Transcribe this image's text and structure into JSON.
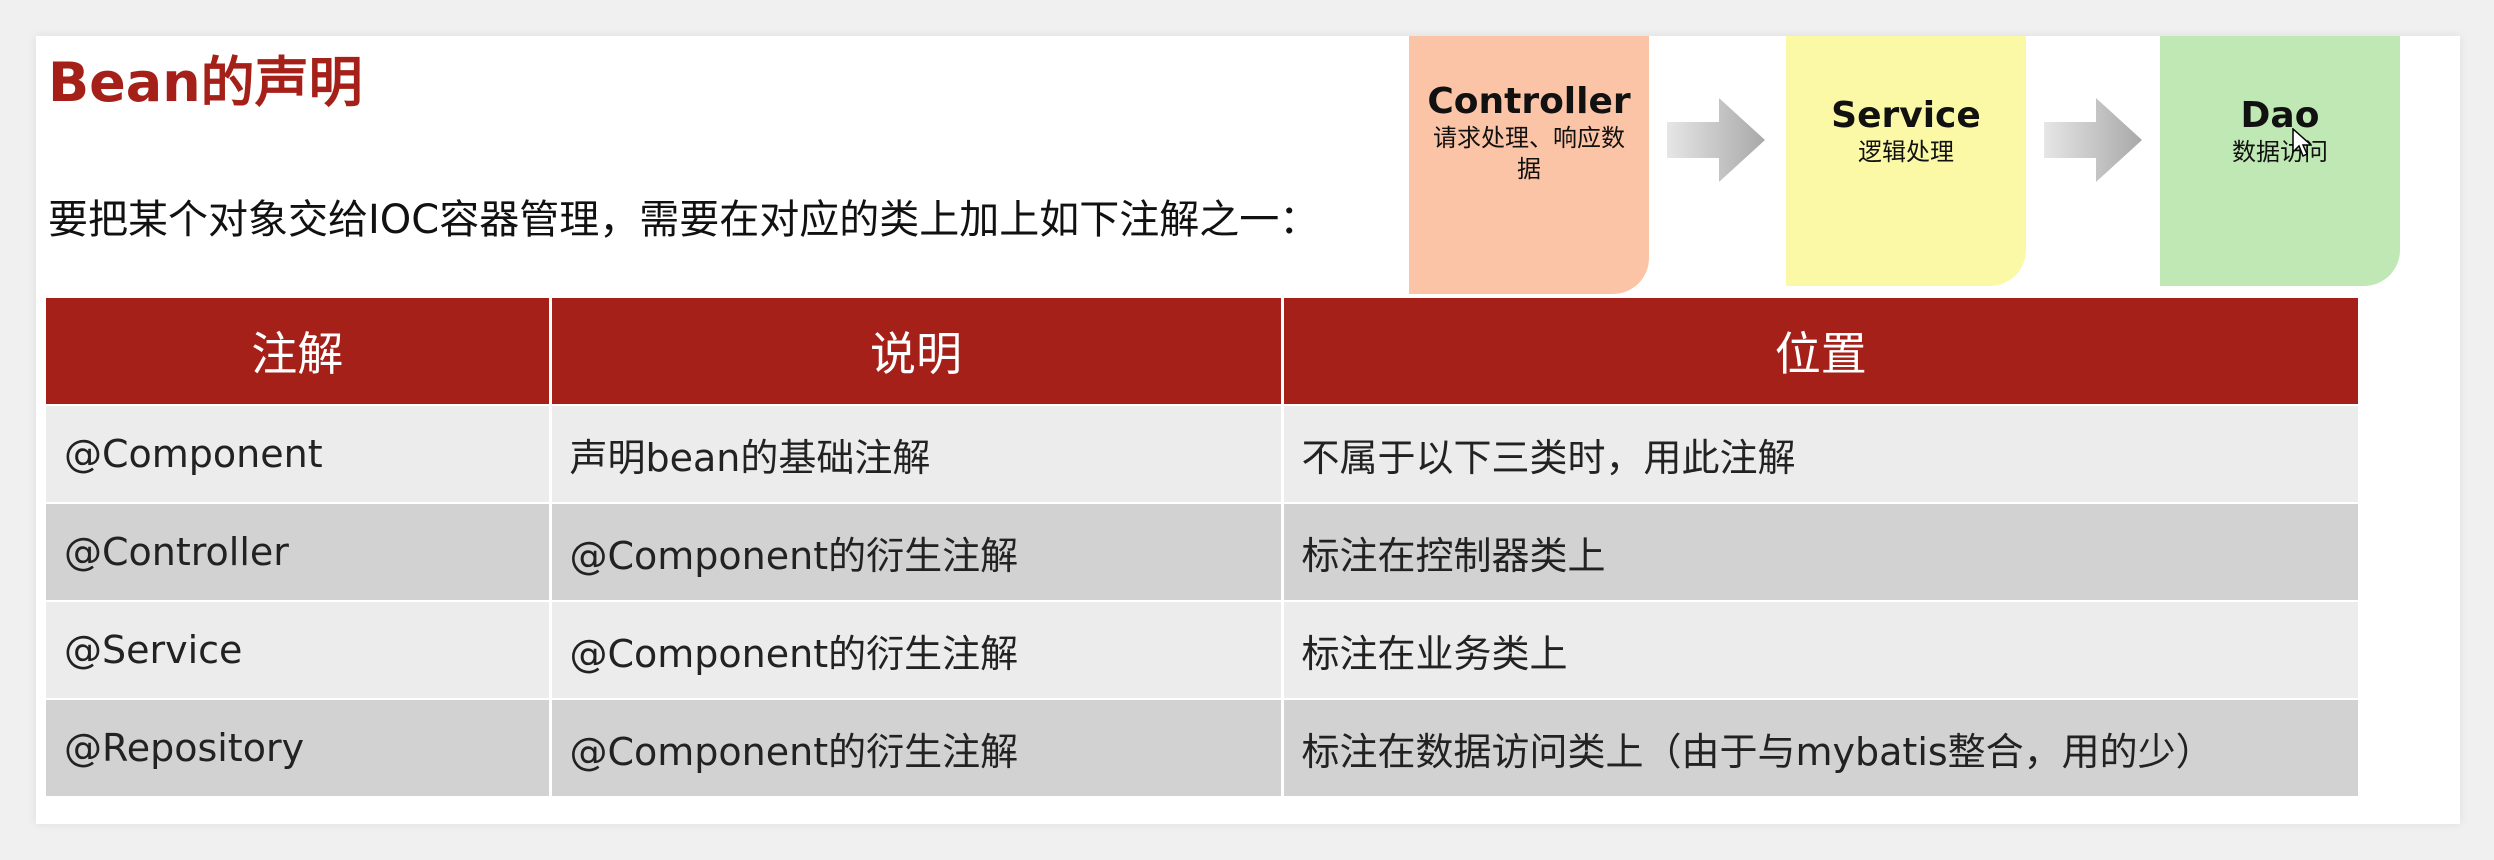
{
  "title": "Bean的声明",
  "subtitle": "要把某个对象交给IOC容器管理，需要在对应的类上加上如下注解之一：",
  "layers": [
    {
      "name": "Controller",
      "desc": "请求处理、响应数据",
      "color": "#fcc4a6"
    },
    {
      "name": "Service",
      "desc": "逻辑处理",
      "color": "#fbf9a6"
    },
    {
      "name": "Dao",
      "desc": "数据访问",
      "color": "#bfe8b4"
    }
  ],
  "table": {
    "header_color": "#a52019",
    "headers": [
      "注解",
      "说明",
      "位置"
    ],
    "rows": [
      [
        "@Component",
        "声明bean的基础注解",
        "不属于以下三类时，用此注解"
      ],
      [
        "@Controller",
        "@Component的衍生注解",
        "标注在控制器类上"
      ],
      [
        "@Service",
        "@Component的衍生注解",
        "标注在业务类上"
      ],
      [
        "@Repository",
        "@Component的衍生注解",
        "标注在数据访问类上（由于与mybatis整合，用的少）"
      ]
    ]
  }
}
